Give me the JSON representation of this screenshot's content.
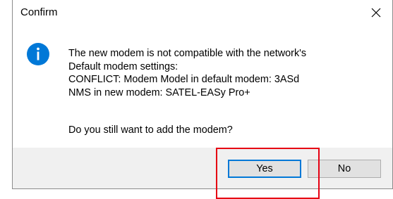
{
  "window": {
    "title": "Confirm",
    "close_icon": "close-icon"
  },
  "message": {
    "icon": "info-icon",
    "lines": [
      "The new modem is not compatible with the network's",
      "Default modem settings:",
      "CONFLICT: Modem Model in default modem: 3ASd",
      "NMS in new modem: SATEL-EASy Pro+"
    ],
    "question": "Do you still want to add the modem?"
  },
  "buttons": {
    "yes_label": "Yes",
    "no_label": "No"
  },
  "colors": {
    "accent": "#0078d7",
    "info_icon": "#0078d7",
    "annotation": "#e60012",
    "footer_bg": "#f0f0f0"
  }
}
